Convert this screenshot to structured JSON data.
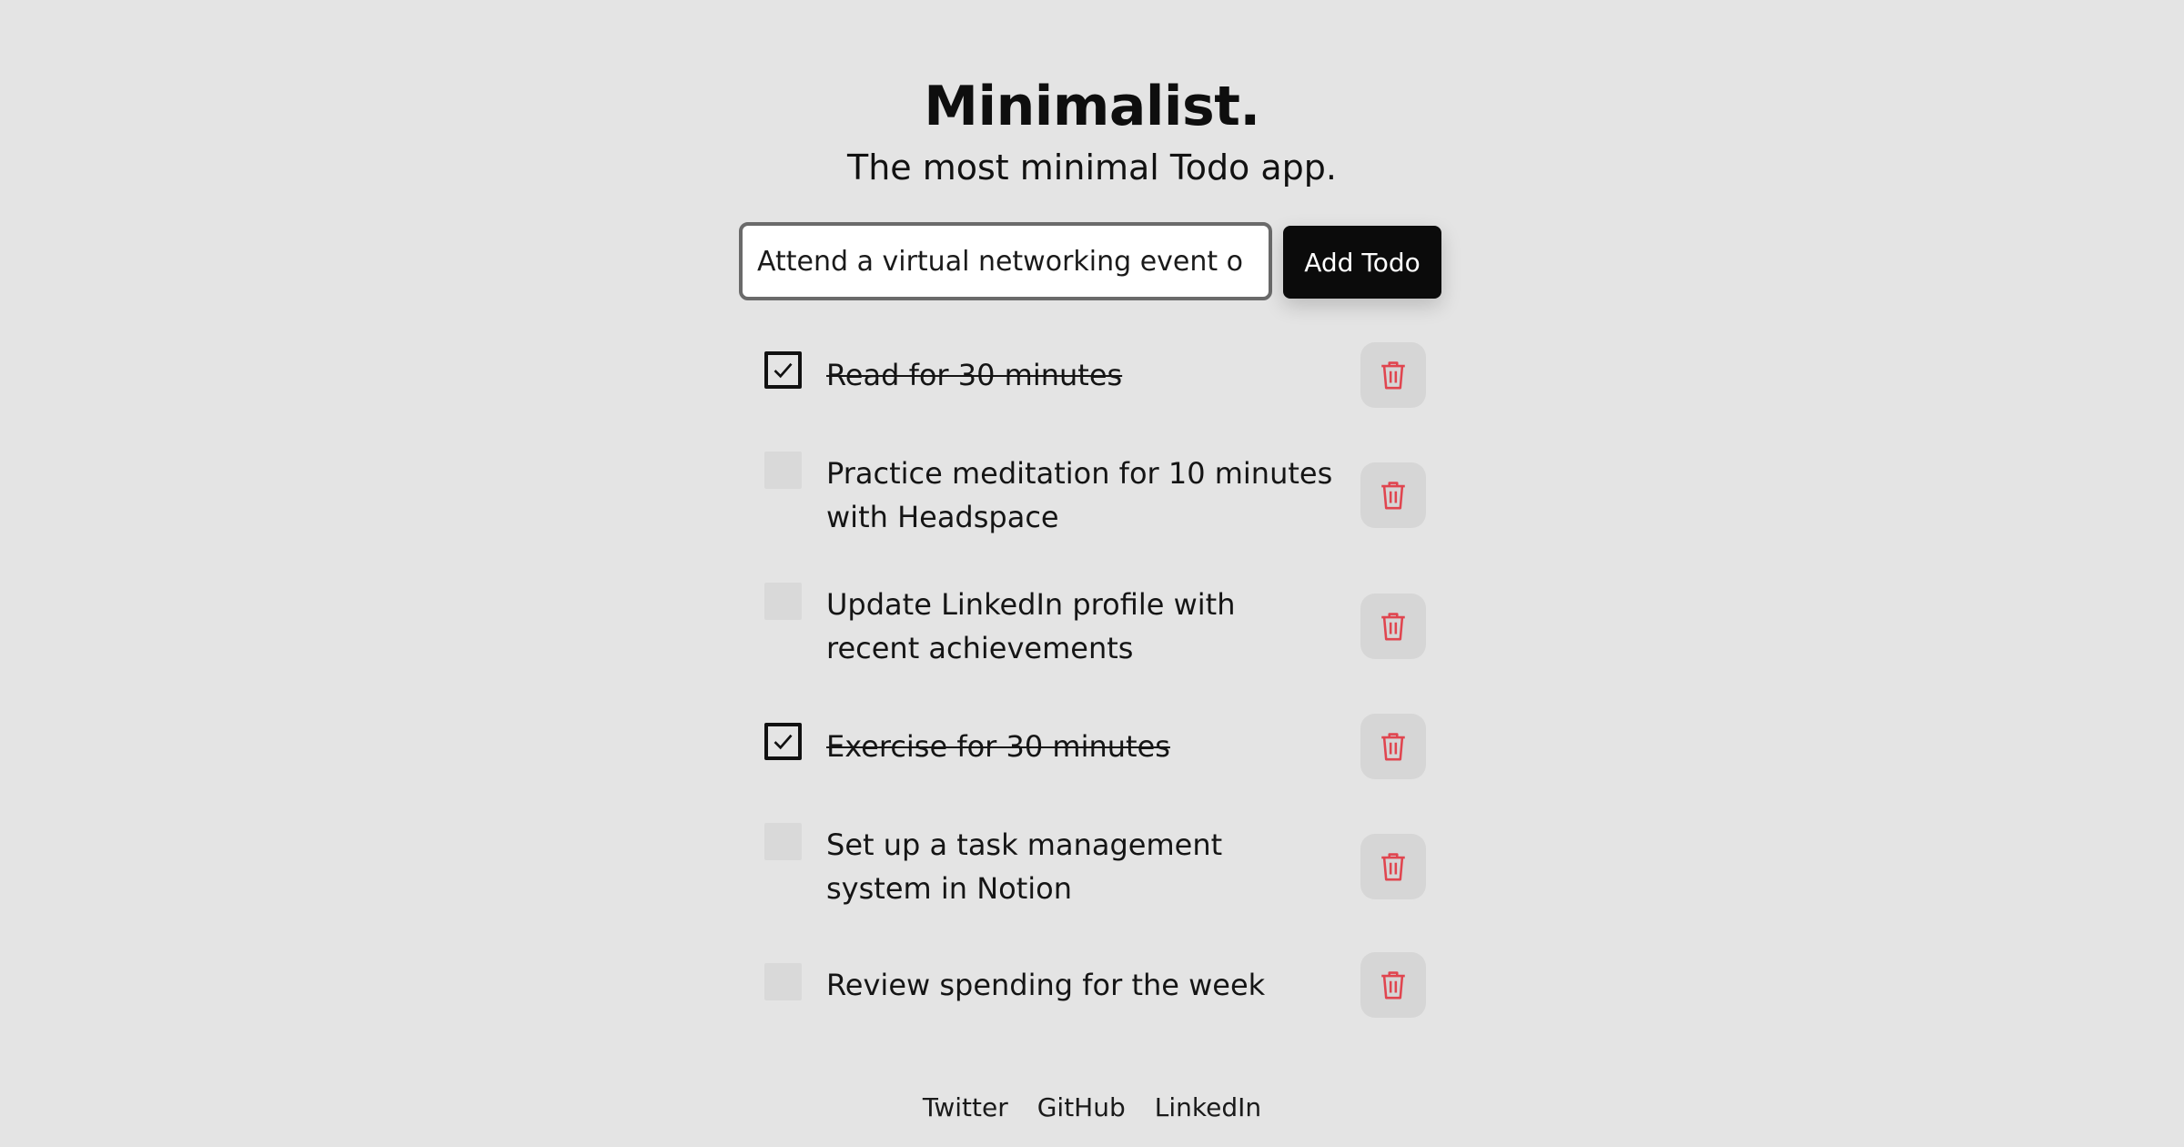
{
  "header": {
    "title": "Minimalist.",
    "subtitle": "The most minimal Todo app."
  },
  "form": {
    "input_value": "Attend a virtual networking event o",
    "add_label": "Add Todo"
  },
  "todos": [
    {
      "text": "Read for 30 minutes",
      "done": true
    },
    {
      "text": "Practice meditation for 10 minutes with Headspace",
      "done": false
    },
    {
      "text": "Update LinkedIn profile with recent achievements",
      "done": false
    },
    {
      "text": "Exercise for 30 minutes",
      "done": true
    },
    {
      "text": "Set up a task management system in Notion",
      "done": false
    },
    {
      "text": "Review spending for the week",
      "done": false
    }
  ],
  "footer": {
    "links": [
      "Twitter",
      "GitHub",
      "LinkedIn"
    ]
  },
  "colors": {
    "background": "#e4e4e4",
    "button": "#0b0b0b",
    "delete_icon": "#e0454f",
    "delete_bg": "#d6d6d6"
  },
  "icons": {
    "check": "check-icon",
    "delete": "trash-icon"
  }
}
